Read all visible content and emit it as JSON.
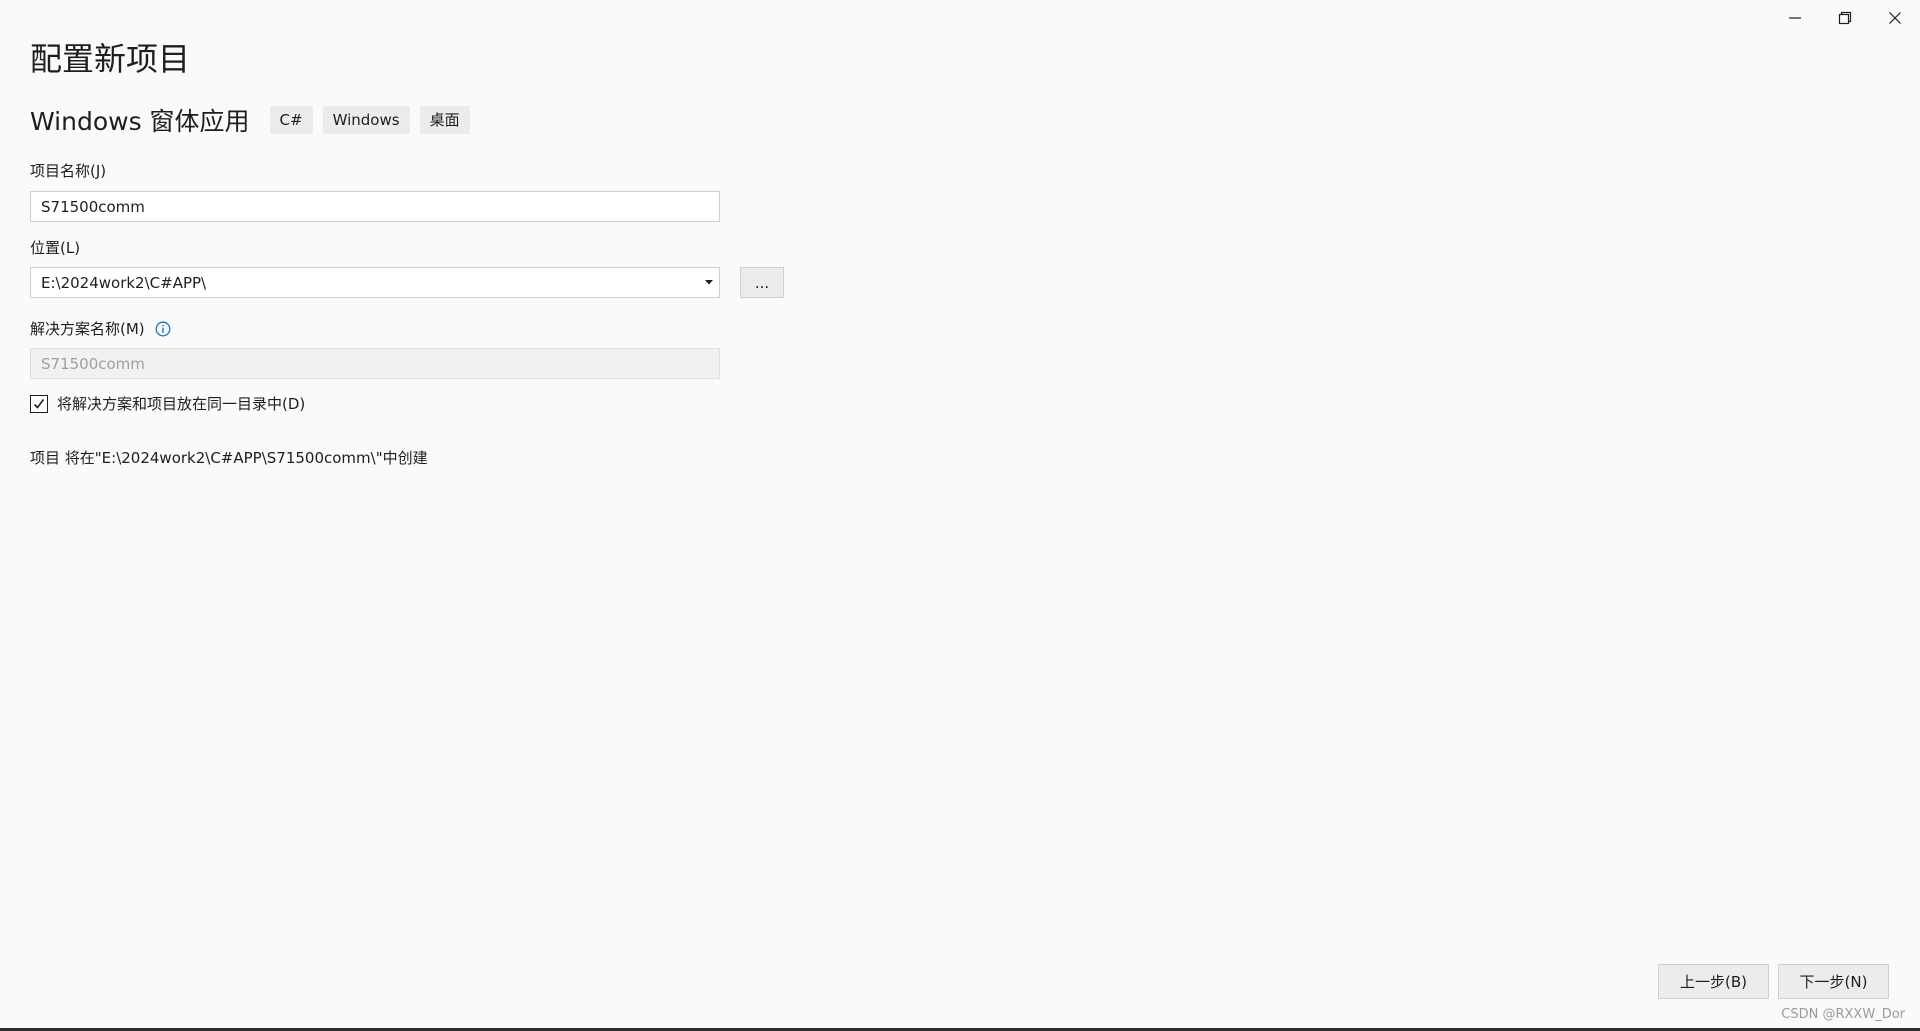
{
  "window": {
    "title": "配置新项目",
    "controls": {
      "minimize_icon": "minimize-icon",
      "restore_icon": "restore-icon",
      "close_icon": "close-icon"
    }
  },
  "template": {
    "name": "Windows 窗体应用",
    "tags": [
      "C#",
      "Windows",
      "桌面"
    ]
  },
  "project_name": {
    "label": "项目名称(J)",
    "value": "S71500comm"
  },
  "location": {
    "label": "位置(L)",
    "value": "E:\\2024work2\\C#APP\\",
    "browse_label": "..."
  },
  "solution_name": {
    "label": "解决方案名称(M)",
    "value": "S71500comm",
    "info_icon": "info-icon",
    "disabled": true
  },
  "same_dir_checkbox": {
    "label": "将解决方案和项目放在同一目录中(D)",
    "checked": true
  },
  "create_path_text": "项目 将在\"E:\\2024work2\\C#APP\\S71500comm\\\"中创建",
  "footer": {
    "back_label": "上一步(B)",
    "next_label": "下一步(N)"
  },
  "watermark": "CSDN @RXXW_Dor",
  "colors": {
    "background": "#fafafa",
    "info_accent": "#1a73c8",
    "border": "#cccedb"
  }
}
